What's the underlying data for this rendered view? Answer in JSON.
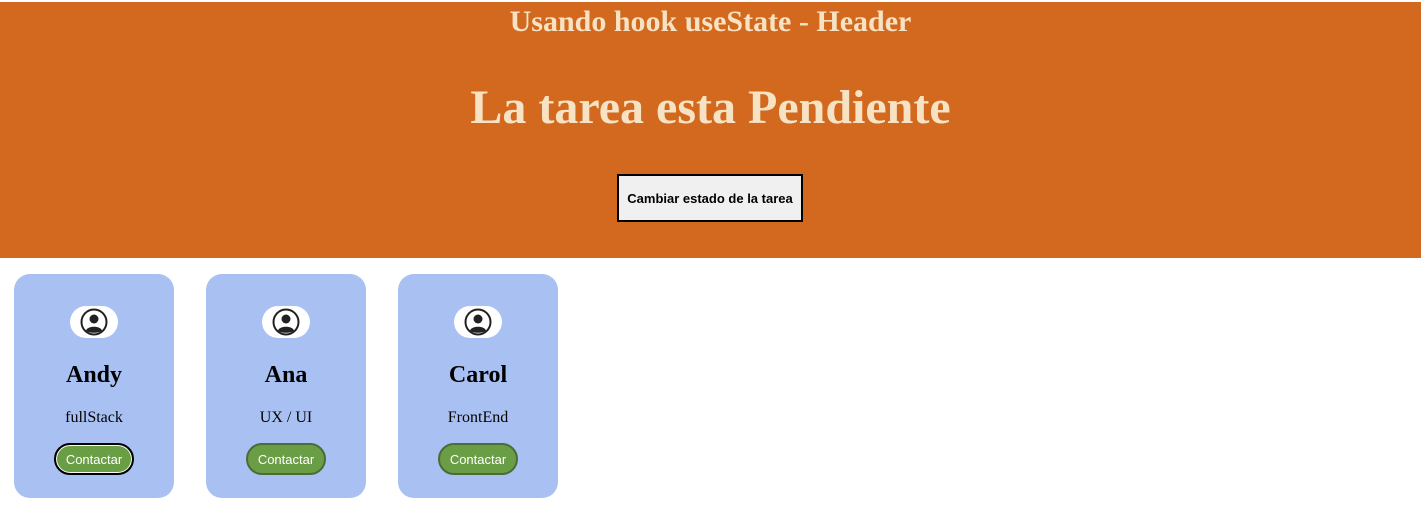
{
  "header": {
    "title": "Usando hook useState - Header",
    "status_text": "La tarea esta Pendiente",
    "toggle_button_label": "Cambiar estado de la tarea"
  },
  "cards": [
    {
      "name": "Andy",
      "role": "fullStack",
      "button_label": "Contactar",
      "icon": "user-avatar-icon"
    },
    {
      "name": "Ana",
      "role": "UX / UI",
      "button_label": "Contactar",
      "icon": "user-avatar-icon"
    },
    {
      "name": "Carol",
      "role": "FrontEnd",
      "button_label": "Contactar",
      "icon": "user-avatar-icon"
    }
  ],
  "colors": {
    "header_bg": "#d2691e",
    "header_text": "#f7e3c4",
    "card_bg": "#a8c1f2",
    "button_bg": "#6a9e45"
  }
}
